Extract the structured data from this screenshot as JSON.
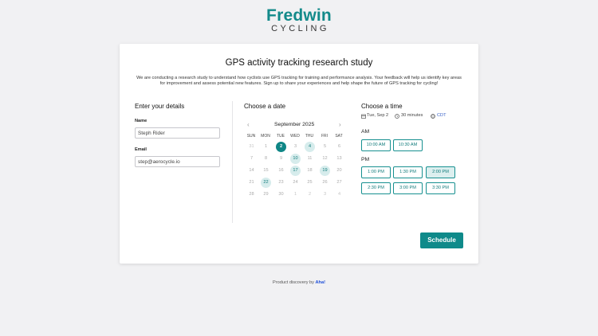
{
  "logo": {
    "main": "Fredwin",
    "sub": "CYCLING"
  },
  "card": {
    "title": "GPS activity tracking research study",
    "intro": "We are conducting a research study to understand how cyclists use GPS tracking for training and performance analysis. Your feedback will help us identify key areas for improvement and assess potential new features. Sign up to share your experiences and help shape the future of GPS tracking for cycling!"
  },
  "details": {
    "heading": "Enter your details",
    "name_label": "Name",
    "name_value": "Steph Rider",
    "email_label": "Email",
    "email_value": "step@aerocycle.io"
  },
  "calendar": {
    "heading": "Choose a date",
    "month": "September 2025",
    "prev_icon": "chevron-left-icon",
    "next_icon": "chevron-right-icon",
    "weekdays": [
      "SUN",
      "MON",
      "TUE",
      "WED",
      "THU",
      "FRI",
      "SAT"
    ],
    "weeks": [
      [
        "31",
        "1",
        "2",
        "3",
        "4",
        "5",
        "6"
      ],
      [
        "7",
        "8",
        "9",
        "10",
        "11",
        "12",
        "13"
      ],
      [
        "14",
        "15",
        "16",
        "17",
        "18",
        "19",
        "20"
      ],
      [
        "21",
        "22",
        "23",
        "24",
        "25",
        "26",
        "27"
      ],
      [
        "28",
        "29",
        "30",
        "1",
        "2",
        "3",
        "4"
      ]
    ],
    "selected": "2",
    "available": [
      "4",
      "10",
      "17",
      "19",
      "22"
    ]
  },
  "time": {
    "heading": "Choose a time",
    "date": "Tue, Sep 2",
    "duration": "30 minutes",
    "timezone": "CDT",
    "am_label": "AM",
    "pm_label": "PM",
    "am_slots": [
      "10:00 AM",
      "10:30 AM"
    ],
    "pm_slots": [
      "1:00 PM",
      "1:30 PM",
      "2:00 PM",
      "2:30 PM",
      "3:00 PM",
      "3:30 PM"
    ],
    "highlighted_slot": "2:00 PM"
  },
  "actions": {
    "schedule_label": "Schedule"
  },
  "footer": {
    "text": "Product discovery by",
    "brand": "Aha!"
  },
  "colors": {
    "accent": "#0f8a8a",
    "available_bg": "#d6ecec",
    "link": "#3a63c8"
  }
}
